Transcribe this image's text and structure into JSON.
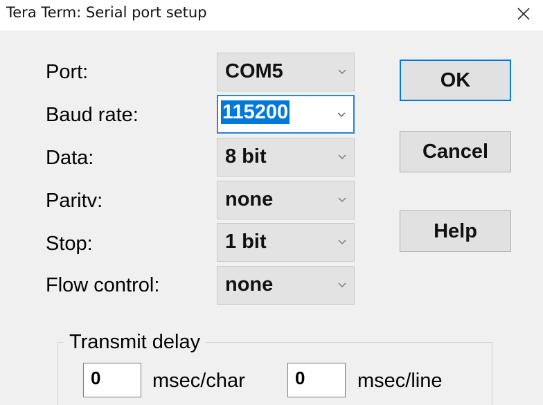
{
  "window": {
    "title": "Tera Term: Serial port setup",
    "close_symbol": "×"
  },
  "fields": [
    {
      "label": "Port:",
      "value": "COM5"
    },
    {
      "label": "Baud rate:",
      "value": "115200"
    },
    {
      "label": "Data:",
      "value": "8 bit"
    },
    {
      "label": "Paritv:",
      "value": "none"
    },
    {
      "label": "Stop:",
      "value": "1 bit"
    },
    {
      "label": "Flow control:",
      "value": "none"
    }
  ],
  "buttons": {
    "ok": "OK",
    "cancel": "Cancel",
    "help": "Help"
  },
  "transmit_delay": {
    "title": "Transmit delay",
    "char_value": "0",
    "char_unit": "msec/char",
    "line_value": "0",
    "line_unit": "msec/line"
  },
  "icons": {
    "close": "close-icon",
    "dropdown": "chevron-down-icon"
  },
  "colors": {
    "selection": "#0078d7",
    "focus_border": "#2a7fd6",
    "background": "#f0f0f0"
  }
}
